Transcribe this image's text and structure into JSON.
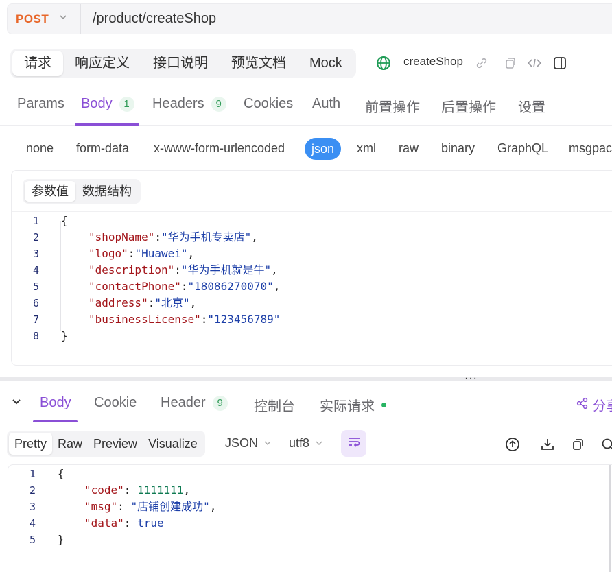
{
  "url_bar": {
    "method": "POST",
    "path": "/product/createShop"
  },
  "top_tabs": [
    "请求",
    "响应定义",
    "接口说明",
    "预览文档",
    "Mock"
  ],
  "api_name": "createShop",
  "request_tabs": {
    "params": "Params",
    "body": "Body",
    "body_count": "1",
    "headers": "Headers",
    "headers_count": "9",
    "cookies": "Cookies",
    "auth": "Auth",
    "pre_ops": "前置操作",
    "post_ops": "后置操作",
    "settings": "设置"
  },
  "body_types": [
    "none",
    "form-data",
    "x-www-form-urlencoded",
    "json",
    "xml",
    "raw",
    "binary",
    "GraphQL",
    "msgpack"
  ],
  "body_type_selected": "json",
  "editor_tabs": [
    "参数值",
    "数据结构"
  ],
  "request_body": {
    "line_numbers": [
      "1",
      "2",
      "3",
      "4",
      "5",
      "6",
      "7",
      "8"
    ],
    "open": "{",
    "fields": [
      {
        "key": "\"shopName\"",
        "value": "\"华为手机专卖店\"",
        "comma": ","
      },
      {
        "key": "\"logo\"",
        "value": "\"Huawei\"",
        "comma": ","
      },
      {
        "key": "\"description\"",
        "value": "\"华为手机就是牛\"",
        "comma": ","
      },
      {
        "key": "\"contactPhone\"",
        "value": "\"18086270070\"",
        "comma": ","
      },
      {
        "key": "\"address\"",
        "value": "\"北京\"",
        "comma": ","
      },
      {
        "key": "\"businessLicense\"",
        "value": "\"123456789\"",
        "comma": ""
      }
    ],
    "close": "}"
  },
  "response_tabs": {
    "body": "Body",
    "cookie": "Cookie",
    "header": "Header",
    "header_count": "9",
    "console": "控制台",
    "actual_request": "实际请求",
    "share": "分享"
  },
  "response_formats": [
    "Pretty",
    "Raw",
    "Preview",
    "Visualize"
  ],
  "response_lang": "JSON",
  "response_encoding": "utf8",
  "response_body": {
    "line_numbers": [
      "1",
      "2",
      "3",
      "4",
      "5"
    ],
    "open": "{",
    "fields": [
      {
        "key": "\"code\"",
        "value": "1111111",
        "comma": ",",
        "type": "number"
      },
      {
        "key": "\"msg\"",
        "value": "\"店铺创建成功\"",
        "comma": ",",
        "type": "string"
      },
      {
        "key": "\"data\"",
        "value": "true",
        "comma": "",
        "type": "bool"
      }
    ],
    "close": "}"
  },
  "icons": {
    "method_dropdown": "chevron-down-icon",
    "globe": "globe-icon",
    "link": "link-icon",
    "copy": "copy-icon",
    "code": "code-icon",
    "panel": "panel-icon",
    "collapse": "chevron-down-icon",
    "share": "share-icon",
    "wrap": "wrap-icon",
    "upload": "upload-icon",
    "download": "download-icon",
    "search": "search-icon"
  },
  "colors": {
    "accent": "#8a4fd6",
    "method": "#e8672a",
    "json_pill": "#3b8ff3",
    "badge_green": "#2e9a56"
  }
}
